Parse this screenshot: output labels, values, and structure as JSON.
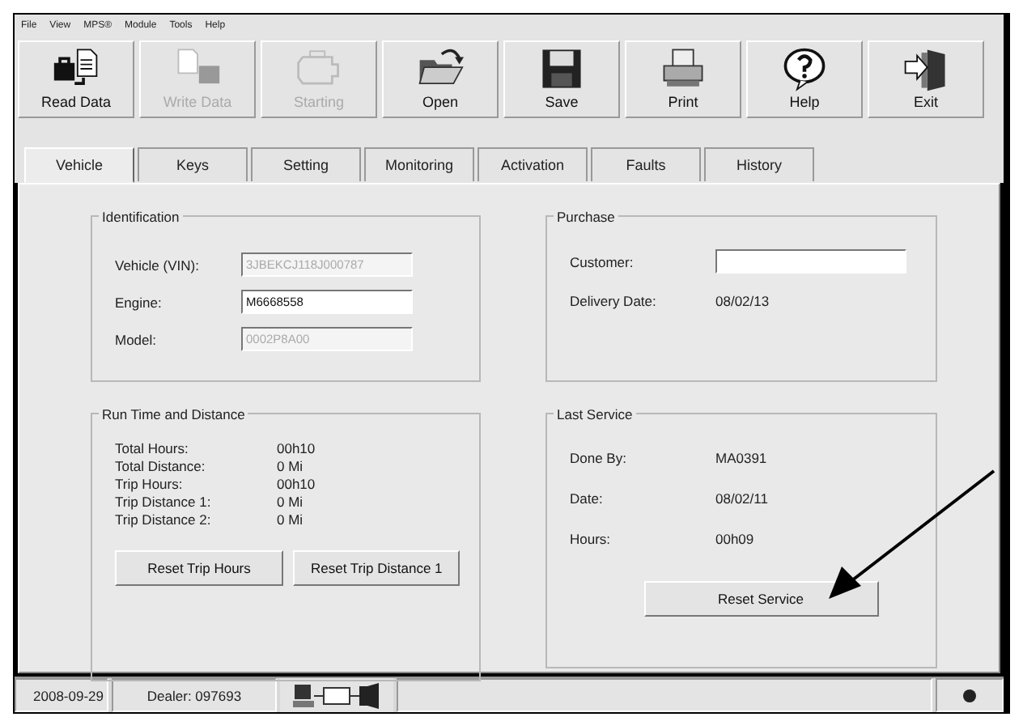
{
  "menu": [
    "File",
    "View",
    "MPS®",
    "Module",
    "Tools",
    "Help"
  ],
  "toolbar": [
    {
      "label": "Read Data",
      "kind": "read",
      "disabled": false
    },
    {
      "label": "Write Data",
      "kind": "write",
      "disabled": true
    },
    {
      "label": "Starting",
      "kind": "engine",
      "disabled": true
    },
    {
      "label": "Open",
      "kind": "open",
      "disabled": false
    },
    {
      "label": "Save",
      "kind": "save",
      "disabled": false
    },
    {
      "label": "Print",
      "kind": "print",
      "disabled": false
    },
    {
      "label": "Help",
      "kind": "help",
      "disabled": false
    },
    {
      "label": "Exit",
      "kind": "exit",
      "disabled": false
    }
  ],
  "tabs": [
    {
      "label": "Vehicle",
      "selected": true
    },
    {
      "label": "Keys",
      "selected": false
    },
    {
      "label": "Setting",
      "selected": false
    },
    {
      "label": "Monitoring",
      "selected": false
    },
    {
      "label": "Activation",
      "selected": false
    },
    {
      "label": "Faults",
      "selected": false
    },
    {
      "label": "History",
      "selected": false
    }
  ],
  "identification": {
    "title": "Identification",
    "fields": [
      {
        "label": "Vehicle (VIN):",
        "value": "3JBEKCJ118J000787",
        "disabled": true
      },
      {
        "label": "Engine:",
        "value": "M6668558",
        "disabled": false
      },
      {
        "label": "Model:",
        "value": "0002P8A00",
        "disabled": true
      }
    ]
  },
  "run_time": {
    "title": "Run Time and Distance",
    "rows": [
      {
        "label": "Total Hours:",
        "value": "00h10"
      },
      {
        "label": "Total Distance:",
        "value": "0 Mi"
      },
      {
        "label": "Trip Hours:",
        "value": "00h10"
      },
      {
        "label": "Trip Distance 1:",
        "value": "0 Mi"
      },
      {
        "label": "Trip Distance 2:",
        "value": "0 Mi"
      }
    ],
    "buttons": [
      "Reset Trip Hours",
      "Reset Trip Distance 1"
    ]
  },
  "purchase": {
    "title": "Purchase",
    "customer_label": "Customer:",
    "delivery_label": "Delivery Date:",
    "delivery_value": "08/02/13"
  },
  "last_service": {
    "title": "Last Service",
    "rows": [
      {
        "label": "Done By:",
        "value": "MA0391"
      },
      {
        "label": "Date:",
        "value": "08/02/11"
      },
      {
        "label": "Hours:",
        "value": "00h09"
      }
    ],
    "button": "Reset Service"
  },
  "status_bar": {
    "date": "2008-09-29",
    "dealer": "Dealer: 097693"
  }
}
